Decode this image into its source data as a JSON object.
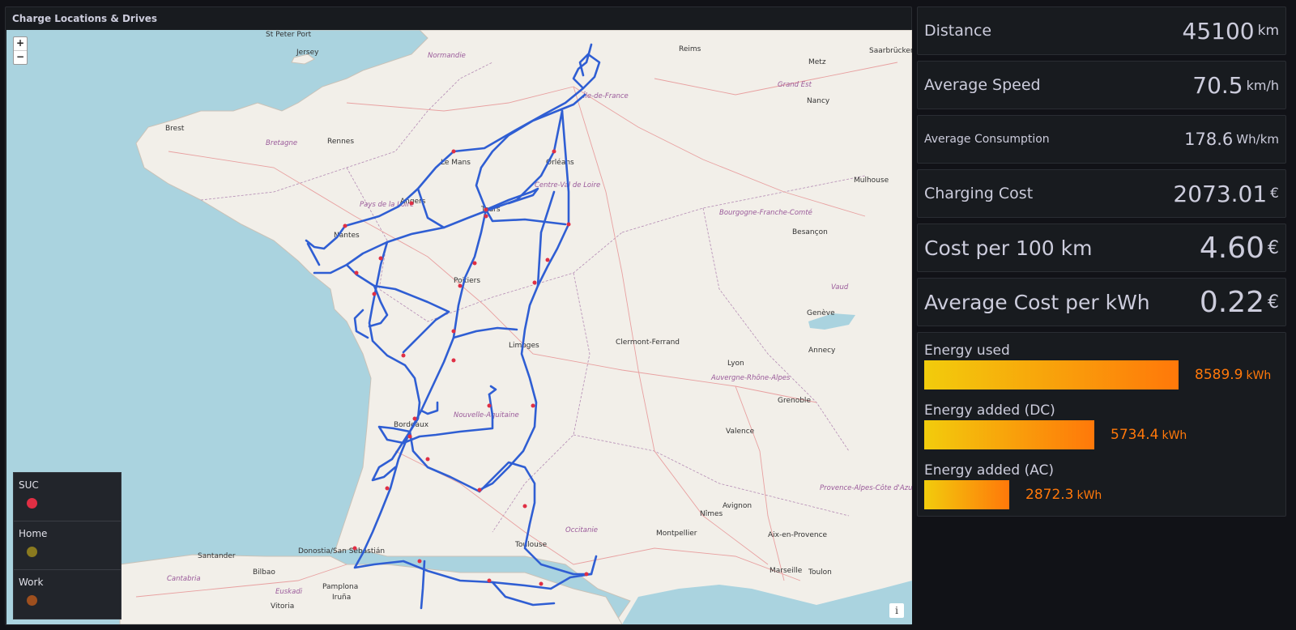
{
  "map": {
    "title": "Charge Locations & Drives",
    "zoom_in": "+",
    "zoom_out": "−",
    "info": "i",
    "place_labels": [
      "St Peter Port",
      "Jersey",
      "Normandie",
      "Reims",
      "Metz",
      "Saarbrücken",
      "Brest",
      "Rennes",
      "Bretagne",
      "Le Mans",
      "Orléans",
      "Grand Est",
      "Nancy",
      "Nantes",
      "Pays de la Loire",
      "Angers",
      "Tours",
      "Centre-Val de Loire",
      "Mulhouse",
      "Bourgogne-Franche-Comté",
      "Besançon",
      "Poitiers",
      "Vaud",
      "Genève",
      "Limoges",
      "Clermont-Ferrand",
      "Lyon",
      "Auvergne-Rhône-Alpes",
      "Annecy",
      "Grenoble",
      "Nouvelle-Aquitaine",
      "Bordeaux",
      "Valence",
      "Occitanie",
      "Toulouse",
      "Nîmes",
      "Avignon",
      "Montpellier",
      "Aix-en-Provence",
      "Marseille",
      "Toulon",
      "Donostia/San Sebastián",
      "Bilbao",
      "Cantabria",
      "Euskadi",
      "Pamplona",
      "Iruña",
      "Vitoria",
      "Santander",
      "Provence-Alpes-Côte d'Azur",
      "Île-de-France"
    ]
  },
  "legend": {
    "items": [
      {
        "label": "SUC",
        "color": "#e02f44"
      },
      {
        "label": "Home",
        "color": "#8a7a1f"
      },
      {
        "label": "Work",
        "color": "#9e4f1e"
      }
    ]
  },
  "stats": {
    "distance": {
      "label": "Distance",
      "value": "45100",
      "unit": "km"
    },
    "speed": {
      "label": "Average Speed",
      "value": "70.5",
      "unit": "km/h"
    },
    "consumption": {
      "label": "Average Consumption",
      "value": "178.6",
      "unit": "Wh/km"
    },
    "cost": {
      "label": "Charging Cost",
      "value": "2073.01",
      "unit": "€"
    },
    "cost100": {
      "label": "Cost per 100 km",
      "value": "4.60",
      "unit": "€"
    },
    "costkwh": {
      "label": "Average Cost per kWh",
      "value": "0.22",
      "unit": "€"
    }
  },
  "energy": {
    "max": 8589.9,
    "items": [
      {
        "label": "Energy used",
        "value": 8589.9,
        "display": "8589.9",
        "unit": "kWh"
      },
      {
        "label": "Energy added (DC)",
        "value": 5734.4,
        "display": "5734.4",
        "unit": "kWh"
      },
      {
        "label": "Energy added (AC)",
        "value": 2872.3,
        "display": "2872.3",
        "unit": "kWh"
      }
    ]
  },
  "colors": {
    "route": "#2f5ed3",
    "charger": "#e02f44",
    "land": "#f2efe9",
    "sea": "#aad3df",
    "accent": "#ff780a"
  }
}
